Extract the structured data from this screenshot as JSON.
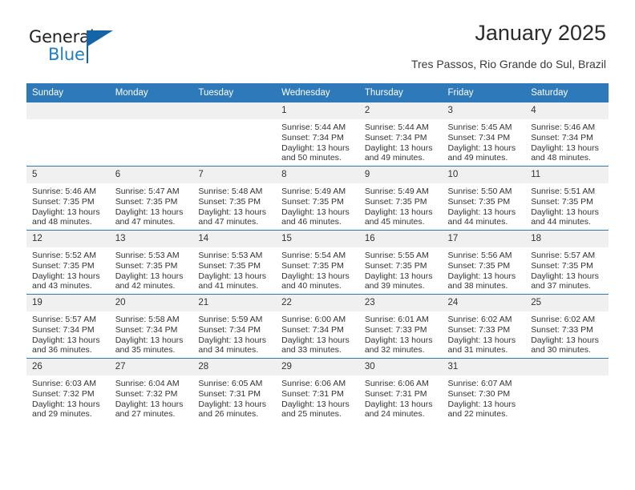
{
  "brand": {
    "name_top": "General",
    "name_bottom": "Blue",
    "logo_icon": "triangle-flag-icon",
    "colors": {
      "dark": "#231f20",
      "blue": "#1f7fc4",
      "triangle": "#1565a6"
    }
  },
  "header": {
    "title": "January 2025",
    "subtitle": "Tres Passos, Rio Grande do Sul, Brazil"
  },
  "calendar": {
    "accent_color": "#2e79b9",
    "daynum_bg": "#f0f0f0",
    "weekdays": [
      "Sunday",
      "Monday",
      "Tuesday",
      "Wednesday",
      "Thursday",
      "Friday",
      "Saturday"
    ],
    "weeks": [
      [
        {
          "day": "",
          "empty": true
        },
        {
          "day": "",
          "empty": true
        },
        {
          "day": "",
          "empty": true
        },
        {
          "day": "1",
          "sunrise": "Sunrise: 5:44 AM",
          "sunset": "Sunset: 7:34 PM",
          "daylight": "Daylight: 13 hours and 50 minutes."
        },
        {
          "day": "2",
          "sunrise": "Sunrise: 5:44 AM",
          "sunset": "Sunset: 7:34 PM",
          "daylight": "Daylight: 13 hours and 49 minutes."
        },
        {
          "day": "3",
          "sunrise": "Sunrise: 5:45 AM",
          "sunset": "Sunset: 7:34 PM",
          "daylight": "Daylight: 13 hours and 49 minutes."
        },
        {
          "day": "4",
          "sunrise": "Sunrise: 5:46 AM",
          "sunset": "Sunset: 7:34 PM",
          "daylight": "Daylight: 13 hours and 48 minutes."
        }
      ],
      [
        {
          "day": "5",
          "sunrise": "Sunrise: 5:46 AM",
          "sunset": "Sunset: 7:35 PM",
          "daylight": "Daylight: 13 hours and 48 minutes."
        },
        {
          "day": "6",
          "sunrise": "Sunrise: 5:47 AM",
          "sunset": "Sunset: 7:35 PM",
          "daylight": "Daylight: 13 hours and 47 minutes."
        },
        {
          "day": "7",
          "sunrise": "Sunrise: 5:48 AM",
          "sunset": "Sunset: 7:35 PM",
          "daylight": "Daylight: 13 hours and 47 minutes."
        },
        {
          "day": "8",
          "sunrise": "Sunrise: 5:49 AM",
          "sunset": "Sunset: 7:35 PM",
          "daylight": "Daylight: 13 hours and 46 minutes."
        },
        {
          "day": "9",
          "sunrise": "Sunrise: 5:49 AM",
          "sunset": "Sunset: 7:35 PM",
          "daylight": "Daylight: 13 hours and 45 minutes."
        },
        {
          "day": "10",
          "sunrise": "Sunrise: 5:50 AM",
          "sunset": "Sunset: 7:35 PM",
          "daylight": "Daylight: 13 hours and 44 minutes."
        },
        {
          "day": "11",
          "sunrise": "Sunrise: 5:51 AM",
          "sunset": "Sunset: 7:35 PM",
          "daylight": "Daylight: 13 hours and 44 minutes."
        }
      ],
      [
        {
          "day": "12",
          "sunrise": "Sunrise: 5:52 AM",
          "sunset": "Sunset: 7:35 PM",
          "daylight": "Daylight: 13 hours and 43 minutes."
        },
        {
          "day": "13",
          "sunrise": "Sunrise: 5:53 AM",
          "sunset": "Sunset: 7:35 PM",
          "daylight": "Daylight: 13 hours and 42 minutes."
        },
        {
          "day": "14",
          "sunrise": "Sunrise: 5:53 AM",
          "sunset": "Sunset: 7:35 PM",
          "daylight": "Daylight: 13 hours and 41 minutes."
        },
        {
          "day": "15",
          "sunrise": "Sunrise: 5:54 AM",
          "sunset": "Sunset: 7:35 PM",
          "daylight": "Daylight: 13 hours and 40 minutes."
        },
        {
          "day": "16",
          "sunrise": "Sunrise: 5:55 AM",
          "sunset": "Sunset: 7:35 PM",
          "daylight": "Daylight: 13 hours and 39 minutes."
        },
        {
          "day": "17",
          "sunrise": "Sunrise: 5:56 AM",
          "sunset": "Sunset: 7:35 PM",
          "daylight": "Daylight: 13 hours and 38 minutes."
        },
        {
          "day": "18",
          "sunrise": "Sunrise: 5:57 AM",
          "sunset": "Sunset: 7:35 PM",
          "daylight": "Daylight: 13 hours and 37 minutes."
        }
      ],
      [
        {
          "day": "19",
          "sunrise": "Sunrise: 5:57 AM",
          "sunset": "Sunset: 7:34 PM",
          "daylight": "Daylight: 13 hours and 36 minutes."
        },
        {
          "day": "20",
          "sunrise": "Sunrise: 5:58 AM",
          "sunset": "Sunset: 7:34 PM",
          "daylight": "Daylight: 13 hours and 35 minutes."
        },
        {
          "day": "21",
          "sunrise": "Sunrise: 5:59 AM",
          "sunset": "Sunset: 7:34 PM",
          "daylight": "Daylight: 13 hours and 34 minutes."
        },
        {
          "day": "22",
          "sunrise": "Sunrise: 6:00 AM",
          "sunset": "Sunset: 7:34 PM",
          "daylight": "Daylight: 13 hours and 33 minutes."
        },
        {
          "day": "23",
          "sunrise": "Sunrise: 6:01 AM",
          "sunset": "Sunset: 7:33 PM",
          "daylight": "Daylight: 13 hours and 32 minutes."
        },
        {
          "day": "24",
          "sunrise": "Sunrise: 6:02 AM",
          "sunset": "Sunset: 7:33 PM",
          "daylight": "Daylight: 13 hours and 31 minutes."
        },
        {
          "day": "25",
          "sunrise": "Sunrise: 6:02 AM",
          "sunset": "Sunset: 7:33 PM",
          "daylight": "Daylight: 13 hours and 30 minutes."
        }
      ],
      [
        {
          "day": "26",
          "sunrise": "Sunrise: 6:03 AM",
          "sunset": "Sunset: 7:32 PM",
          "daylight": "Daylight: 13 hours and 29 minutes."
        },
        {
          "day": "27",
          "sunrise": "Sunrise: 6:04 AM",
          "sunset": "Sunset: 7:32 PM",
          "daylight": "Daylight: 13 hours and 27 minutes."
        },
        {
          "day": "28",
          "sunrise": "Sunrise: 6:05 AM",
          "sunset": "Sunset: 7:31 PM",
          "daylight": "Daylight: 13 hours and 26 minutes."
        },
        {
          "day": "29",
          "sunrise": "Sunrise: 6:06 AM",
          "sunset": "Sunset: 7:31 PM",
          "daylight": "Daylight: 13 hours and 25 minutes."
        },
        {
          "day": "30",
          "sunrise": "Sunrise: 6:06 AM",
          "sunset": "Sunset: 7:31 PM",
          "daylight": "Daylight: 13 hours and 24 minutes."
        },
        {
          "day": "31",
          "sunrise": "Sunrise: 6:07 AM",
          "sunset": "Sunset: 7:30 PM",
          "daylight": "Daylight: 13 hours and 22 minutes."
        },
        {
          "day": "",
          "empty": true
        }
      ]
    ]
  }
}
